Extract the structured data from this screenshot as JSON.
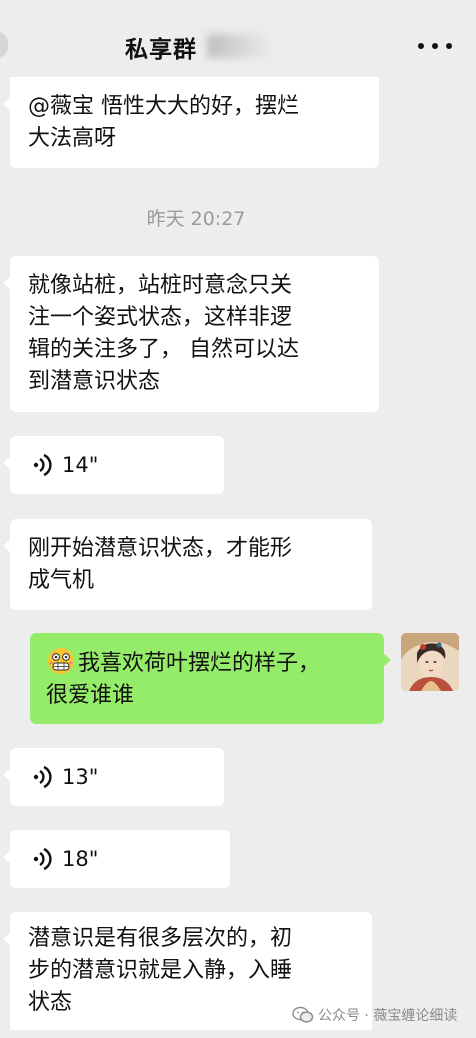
{
  "header": {
    "title": "私享群",
    "more_icon": "more-dots-icon",
    "back_icon": "back-icon"
  },
  "messages": [
    {
      "side": "left",
      "type": "text",
      "text": "@薇宝 悟性大大的好，摆烂\n大法高呀"
    },
    {
      "type": "time",
      "text": "昨天 20:27"
    },
    {
      "side": "left",
      "type": "text",
      "text": "就像站桩，站桩时意念只关\n注一个姿式状态，这样非逻\n辑的关注多了， 自然可以达\n到潜意识状态"
    },
    {
      "side": "left",
      "type": "voice",
      "duration": "14\""
    },
    {
      "side": "left",
      "type": "text",
      "text": "刚开始潜意识状态，才能形\n成气机"
    },
    {
      "side": "right",
      "type": "text",
      "emoji": "grimacing-face-emoji",
      "text": "我喜欢荷叶摆烂的样子，\n很爱谁谁"
    },
    {
      "side": "left",
      "type": "voice",
      "duration": "13\""
    },
    {
      "side": "left",
      "type": "voice",
      "duration": "18\""
    },
    {
      "side": "left",
      "type": "text",
      "text": "潜意识是有很多层次的，初\n步的潜意识就是入静，入睡\n状态"
    }
  ],
  "watermark": {
    "text": "公众号 · 薇宝缠论细读",
    "icon": "wechat-official-account-icon"
  },
  "colors": {
    "background": "#ededed",
    "incoming_bubble": "#ffffff",
    "outgoing_bubble": "#95ec69"
  }
}
